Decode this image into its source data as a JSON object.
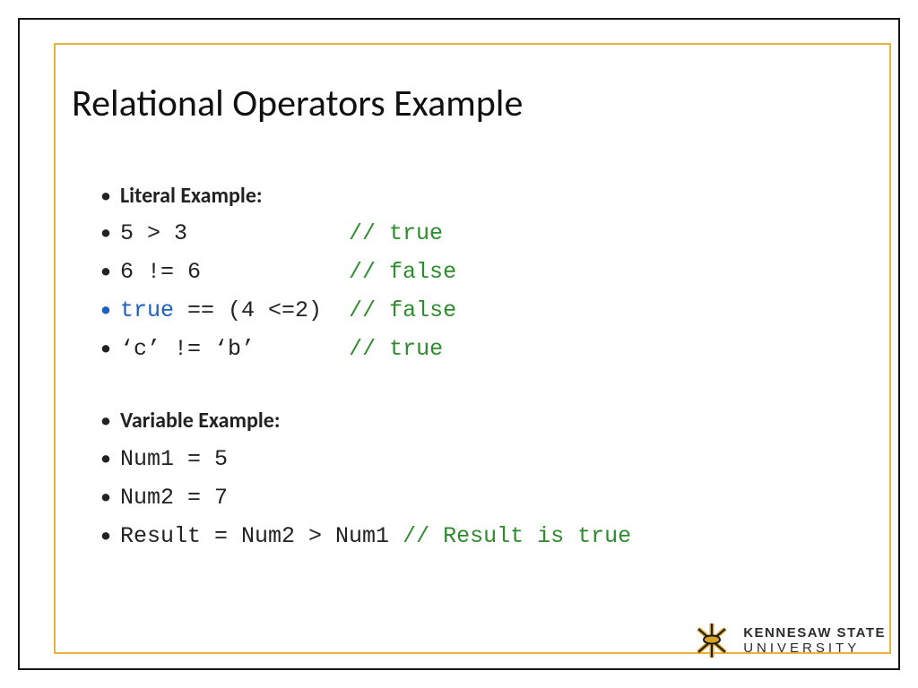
{
  "title": "Relational Operators Example",
  "sections": {
    "literal": {
      "heading": "Literal Example:",
      "rows": [
        {
          "code": "5 > 3",
          "pad": "            ",
          "comment": "// true"
        },
        {
          "code": "6 != 6",
          "pad": "           ",
          "comment": "// false"
        },
        {
          "keyword": "true",
          "code": " == (4 <=2)",
          "pad": "  ",
          "comment": "// false",
          "bullet": "blue"
        },
        {
          "code": "‘c’ != ‘b’",
          "pad": "       ",
          "comment": "// true"
        }
      ]
    },
    "variable": {
      "heading": "Variable Example:",
      "rows": [
        {
          "code": "Num1 = 5"
        },
        {
          "code": "Num2 = 7"
        },
        {
          "code": "Result = Num2 > Num1 ",
          "comment": "// Result is true"
        }
      ]
    }
  },
  "logo": {
    "line1": "KENNESAW STATE",
    "line2": "UNIVERSITY"
  }
}
